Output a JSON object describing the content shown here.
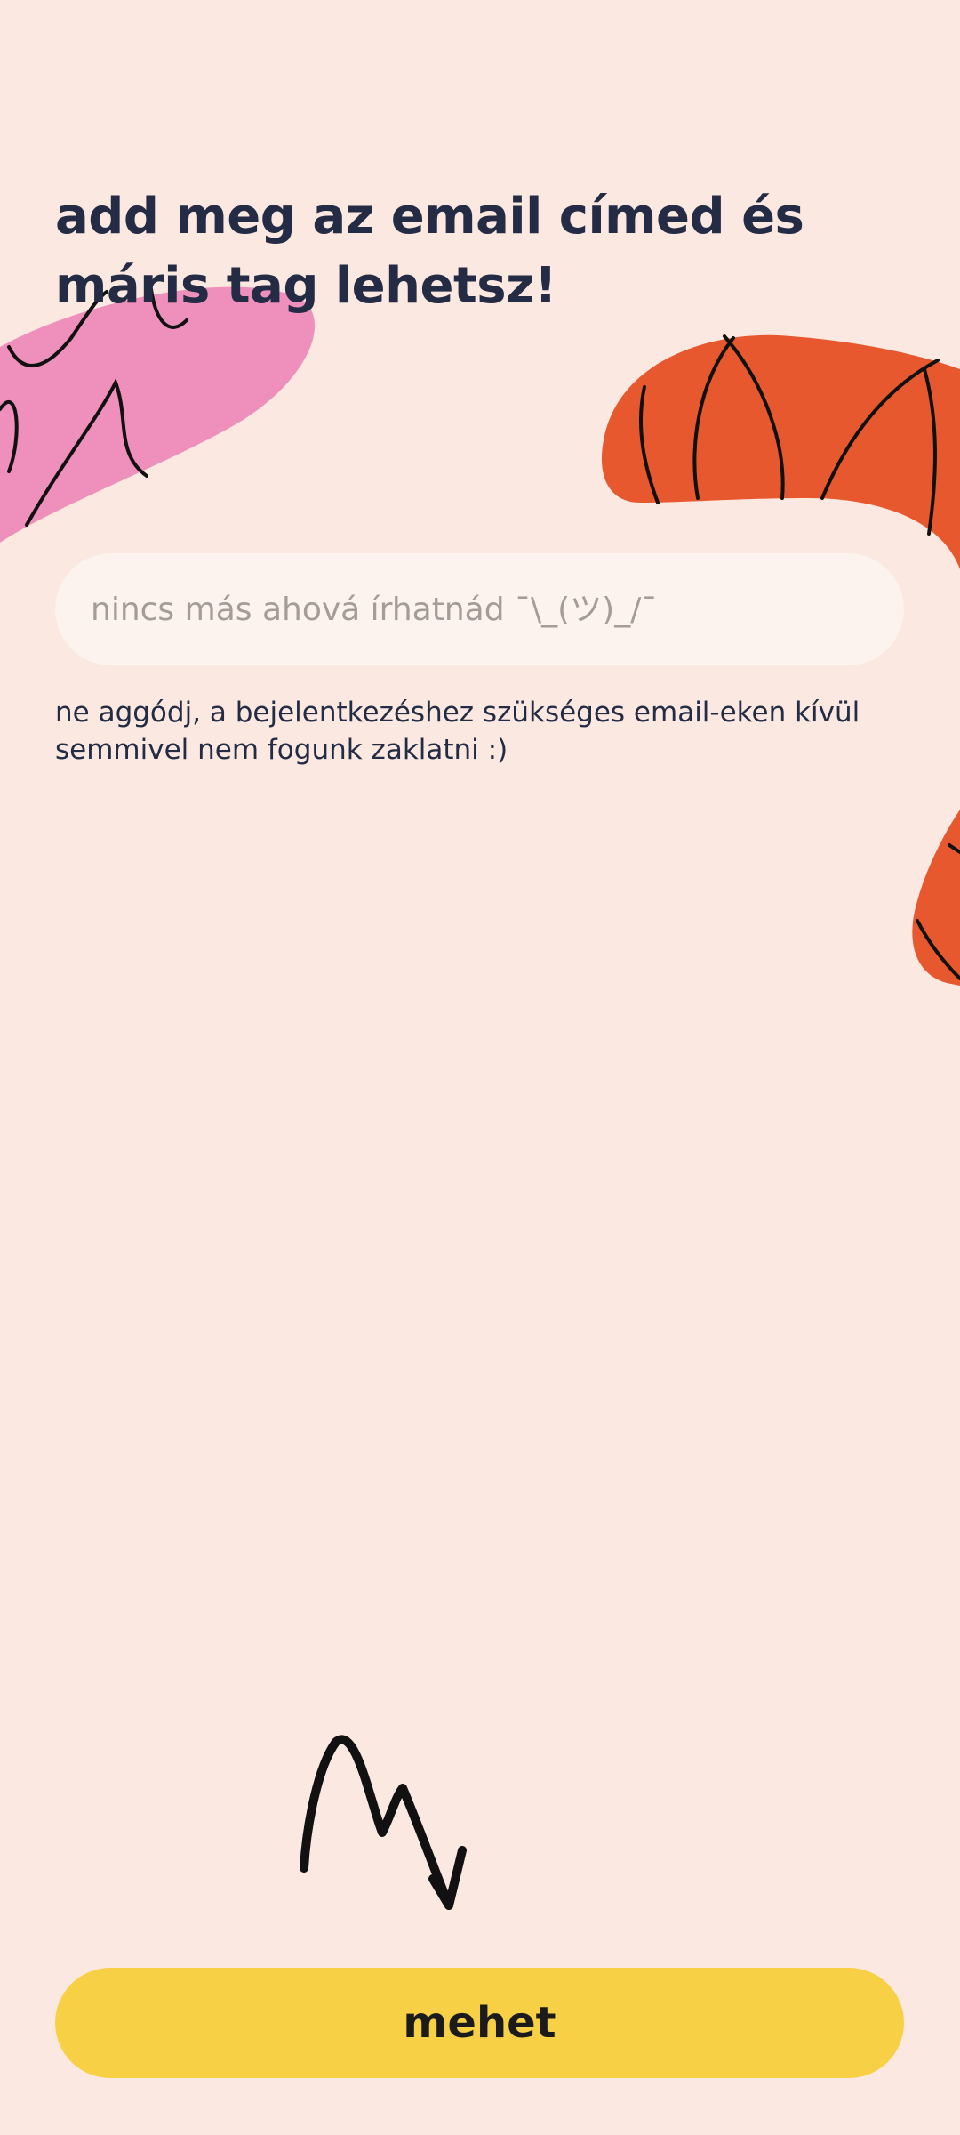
{
  "header": {
    "title": "add meg az email címed és máris tag lehetsz!"
  },
  "form": {
    "email_placeholder": "nincs más ahová írhatnád ¯\\_(ツ)_/¯",
    "email_value": "",
    "note": "ne aggódj, a bejelentkezéshez szükséges email-eken kívül semmivel nem fogunk zaklatni :)",
    "submit_label": "mehet"
  },
  "colors": {
    "background": "#fbe8e0",
    "text": "#232b45",
    "pink_blob": "#ee90bb",
    "orange_blob": "#e8582f",
    "button": "#f8d046",
    "field": "#fcf2ee"
  },
  "icons": {
    "arrow": "squiggle-arrow-icon"
  }
}
